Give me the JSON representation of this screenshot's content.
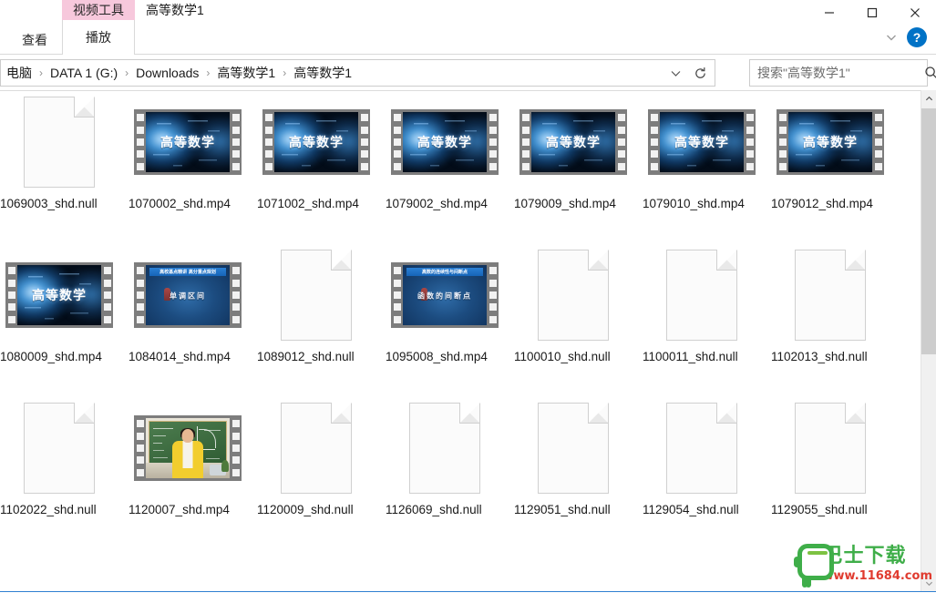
{
  "window": {
    "title": "高等数学1",
    "contextual_tab_group": "视频工具",
    "minimize_label": "最小化",
    "maximize_label": "最大化",
    "close_label": "关闭"
  },
  "ribbon": {
    "tabs": [
      {
        "label": "查看",
        "active": false
      },
      {
        "label": "播放",
        "active": true
      }
    ],
    "collapse_label": "折叠功能区",
    "help_label": "?"
  },
  "address": {
    "breadcrumbs": [
      "电脑",
      "DATA 1 (G:)",
      "Downloads",
      "高等数学1",
      "高等数学1"
    ],
    "separator": "›",
    "dropdown_label": "历史记录",
    "refresh_label": "刷新"
  },
  "search": {
    "placeholder": "搜索\"高等数学1\"",
    "value": "",
    "icon": "search-icon"
  },
  "colors": {
    "contextual_tab": "#f7c8dc",
    "help_button": "#0072c6",
    "status_accent": "#2f7fd1",
    "scroll_thumb": "#cdcdcd",
    "watermark_green": "#3fae49",
    "watermark_red": "#e03b2f"
  },
  "files": [
    {
      "name": "1069003_shd.null",
      "type": "blank-doc",
      "thumb": "document"
    },
    {
      "name": "1070002_shd.mp4",
      "type": "video",
      "thumb": "math-poster",
      "thumb_text": "高等数学"
    },
    {
      "name": "1071002_shd.mp4",
      "type": "video",
      "thumb": "math-poster",
      "thumb_text": "高等数学"
    },
    {
      "name": "1079002_shd.mp4",
      "type": "video",
      "thumb": "math-poster",
      "thumb_text": "高等数学"
    },
    {
      "name": "1079009_shd.mp4",
      "type": "video",
      "thumb": "math-poster",
      "thumb_text": "高等数学"
    },
    {
      "name": "1079010_shd.mp4",
      "type": "video",
      "thumb": "math-poster",
      "thumb_text": "高等数学"
    },
    {
      "name": "1079012_shd.mp4",
      "type": "video",
      "thumb": "math-poster",
      "thumb_text": "高等数学"
    },
    {
      "name": "1080009_shd.mp4",
      "type": "video",
      "thumb": "math-poster",
      "thumb_text": "高等数学"
    },
    {
      "name": "1084014_shd.mp4",
      "type": "video",
      "thumb": "blue-slide",
      "thumb_header": "高校基点精讲 高分重点规划",
      "thumb_text": "单调区间"
    },
    {
      "name": "1089012_shd.null",
      "type": "blank-doc",
      "thumb": "document"
    },
    {
      "name": "1095008_shd.mp4",
      "type": "video",
      "thumb": "blue-slide",
      "thumb_header": "高数的连续性与间断点",
      "thumb_text": "函数的间断点"
    },
    {
      "name": "1100010_shd.null",
      "type": "blank-doc",
      "thumb": "document"
    },
    {
      "name": "1100011_shd.null",
      "type": "blank-doc",
      "thumb": "document"
    },
    {
      "name": "1102013_shd.null",
      "type": "blank-doc",
      "thumb": "document"
    },
    {
      "name": "1102022_shd.null",
      "type": "blank-doc",
      "thumb": "document"
    },
    {
      "name": "1120007_shd.mp4",
      "type": "video",
      "thumb": "classroom"
    },
    {
      "name": "1120009_shd.null",
      "type": "blank-doc",
      "thumb": "document"
    },
    {
      "name": "1126069_shd.null",
      "type": "blank-doc",
      "thumb": "document"
    },
    {
      "name": "1129051_shd.null",
      "type": "blank-doc",
      "thumb": "document"
    },
    {
      "name": "1129054_shd.null",
      "type": "blank-doc",
      "thumb": "document"
    },
    {
      "name": "1129055_shd.null",
      "type": "blank-doc",
      "thumb": "document"
    }
  ],
  "watermark": {
    "brand": "巴士下载",
    "url": "www.11684.com"
  }
}
